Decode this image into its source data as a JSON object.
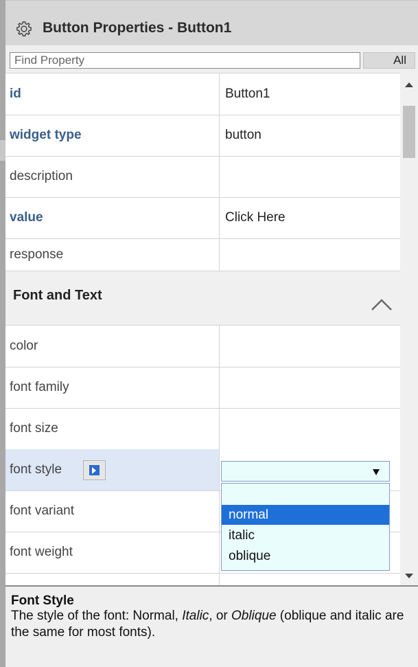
{
  "window": {
    "title": "Button Properties - Button1"
  },
  "search": {
    "placeholder": "Find Property",
    "all_label": "All"
  },
  "properties": [
    {
      "name": "id",
      "value": "Button1",
      "bold": true
    },
    {
      "name": "widget type",
      "value": "button",
      "bold": true
    },
    {
      "name": "description",
      "value": "",
      "bold": false
    },
    {
      "name": "value",
      "value": "Click Here",
      "bold": true
    },
    {
      "name": "response",
      "value": "",
      "bold": false
    }
  ],
  "section": {
    "title": "Font and Text",
    "state": "expanded"
  },
  "font_properties": [
    {
      "name": "color",
      "value": ""
    },
    {
      "name": "font family",
      "value": ""
    },
    {
      "name": "font size",
      "value": ""
    },
    {
      "name": "font style",
      "value": "",
      "selected": true
    },
    {
      "name": "font variant",
      "value": ""
    },
    {
      "name": "font weight",
      "value": ""
    }
  ],
  "font_style_dropdown": {
    "selected_value": "",
    "options": [
      "",
      "normal",
      "italic",
      "oblique"
    ],
    "highlighted": "normal"
  },
  "help": {
    "title": "Font Style",
    "text_before": "The style of the font: Normal, ",
    "italic1": "Italic",
    "text_mid": ", or ",
    "italic2": "Oblique",
    "text_after": " (oblique and italic are the same for most fonts)."
  },
  "colors": {
    "titlebar": "#d7d7d7",
    "bold_property": "#3a5f8c",
    "selected_row": "#dde7f6",
    "dropdown_bg": "#eafdfd",
    "highlight": "#1e6fd8"
  },
  "icons": {
    "title": "gear-icon",
    "section_toggle": "chevron-up-icon",
    "font_style_button": "expression-icon",
    "select_arrow": "dropdown-arrow-icon"
  }
}
